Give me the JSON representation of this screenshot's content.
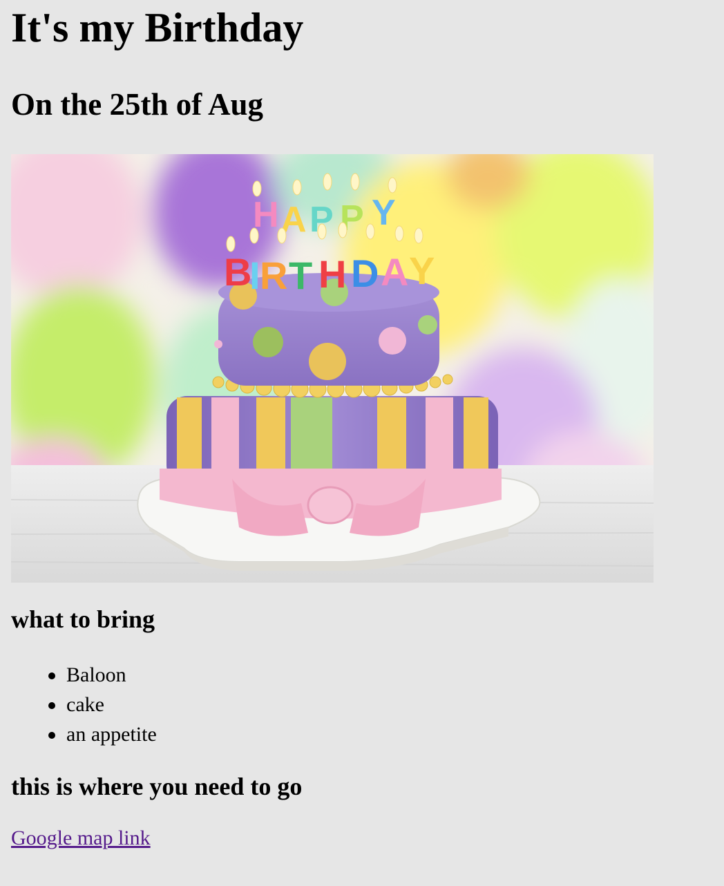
{
  "header": {
    "title": "It's my Birthday",
    "subtitle": "On the 25th of Aug"
  },
  "image": {
    "candle_letters_top": "HAPPY",
    "candle_letters_bottom": "BIRTHDAY"
  },
  "bring_section": {
    "heading": "what to bring",
    "items": [
      "Baloon",
      "cake",
      "an appetite"
    ]
  },
  "directions_section": {
    "heading": "this is where you need to go",
    "link_text": "Google map link"
  },
  "colors": {
    "background": "#e6e6e6",
    "visited_link": "#551a8b",
    "cake_purple": "#9b83cf",
    "stripe_yellow": "#f0c85a",
    "stripe_green": "#a9d27c",
    "ribbon_pink": "#f4b8cf"
  }
}
